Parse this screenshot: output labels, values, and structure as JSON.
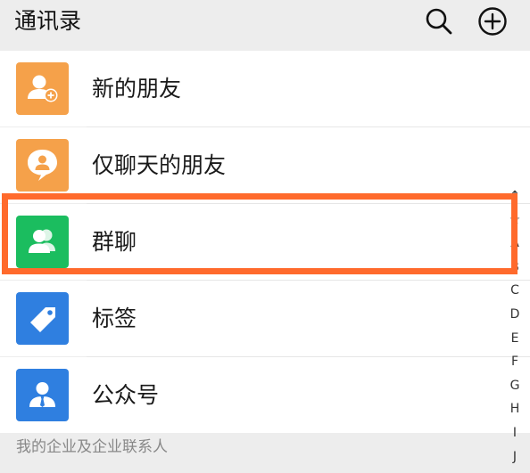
{
  "header": {
    "title": "通讯录",
    "search_icon": "search-icon",
    "add_icon": "add-circle-icon"
  },
  "list": {
    "items": [
      {
        "label": "新的朋友",
        "icon": "add-friend-icon",
        "color": "#f5a14a"
      },
      {
        "label": "仅聊天的朋友",
        "icon": "chat-only-icon",
        "color": "#f5a14a"
      },
      {
        "label": "群聊",
        "icon": "group-chat-icon",
        "color": "#1bbd5f"
      },
      {
        "label": "标签",
        "icon": "tag-icon",
        "color": "#2f7fe0"
      },
      {
        "label": "公众号",
        "icon": "official-account-icon",
        "color": "#2f7fe0"
      }
    ]
  },
  "section": {
    "label": "我的企业及企业联系人"
  },
  "index_bar": {
    "letters": [
      "↑",
      "☆",
      "A",
      "B",
      "C",
      "D",
      "E",
      "F",
      "G",
      "H",
      "I",
      "J"
    ]
  },
  "highlight": {
    "color": "#ff6a2c",
    "target": "群聊"
  }
}
